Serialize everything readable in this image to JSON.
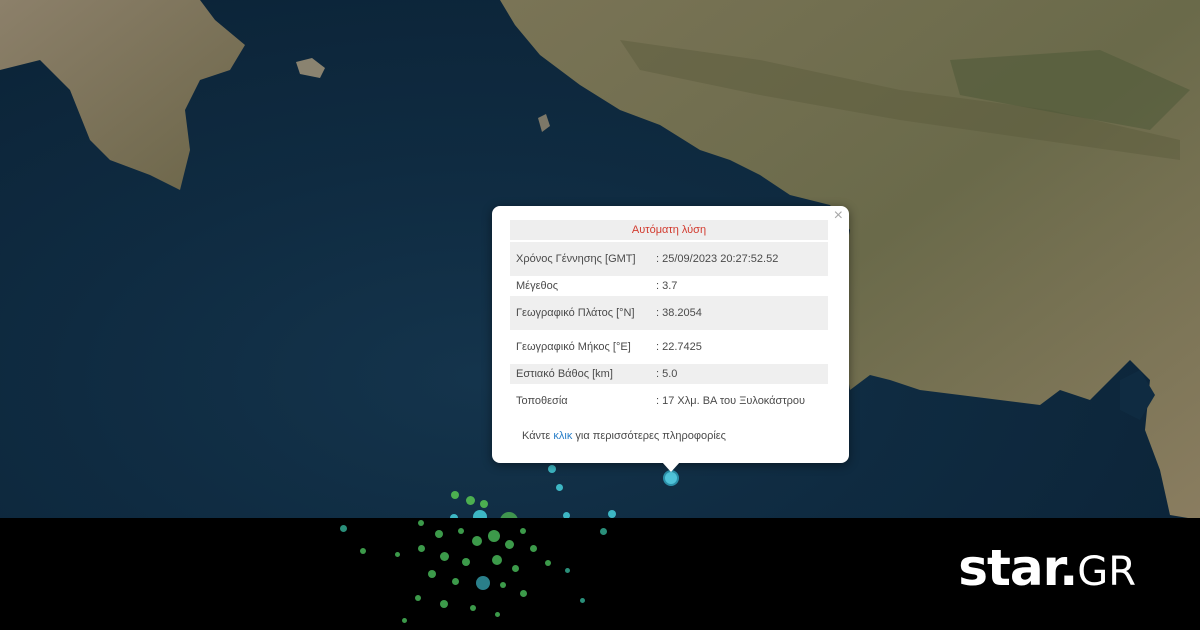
{
  "popup": {
    "title": "Αυτόματη λύση",
    "close_glyph": "×",
    "rows": [
      {
        "label": "Χρόνος Γέννησης [GMT]",
        "value": ": 25/09/2023 20:27:52.52"
      },
      {
        "label": "Μέγεθος",
        "value": ": 3.7"
      },
      {
        "label": "Γεωγραφικό Πλάτος [°N]",
        "value": ": 38.2054"
      },
      {
        "label": "Γεωγραφικό Μήκος [°E]",
        "value": ": 22.7425"
      },
      {
        "label": "Εστιακό Βάθος [km]",
        "value": ": 5.0"
      },
      {
        "label": "Τοποθεσία",
        "value": ": 17 Χλμ. ΒΑ του Ξυλοκάστρου"
      }
    ],
    "footer_before": "Κάντε ",
    "footer_link": "κλικ",
    "footer_after": " για περισσότερες πληροφορίες"
  },
  "logo": {
    "main": "star",
    "dot": ".",
    "suffix": "GR"
  },
  "colors": {
    "sea": "#0f2b41",
    "land": "#6f6a4e",
    "popup_title": "#d23b2f",
    "link": "#2a7fc8",
    "quake_main": "#4fc3d9",
    "quake_green": "#4caf50",
    "bottom_bar": "#000000"
  }
}
